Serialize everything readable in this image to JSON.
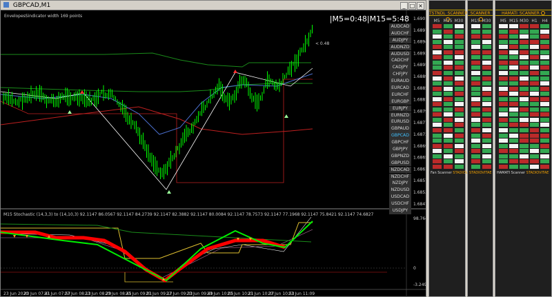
{
  "window": {
    "title": "GBPCAD,M1"
  },
  "chart": {
    "indicator_label": "EnvelopesSindicator width 169 points",
    "timer_text": "|M5=0:48|M15=5:48",
    "price_tag": "< 0.48",
    "price_labels": [
      "1.69015",
      "1.68975",
      "1.68945",
      "1.68935",
      "1.68955",
      "1.68895",
      "1.68855",
      "1.68815",
      "1.68795",
      "1.68775",
      "1.68735",
      "1.68695",
      "1.68655",
      "1.68615",
      "1.68575",
      "1.68535",
      "1.68475"
    ],
    "stoch_label": "M15 Stochastic (14,3,3) to (14,10,3) 92.1147 86.0567 92.1147 84.2739 92.1147 82.3882 92.1147 80.0084 92.1147 78.7573 92.1147 77.1968 92.1147 75.8421 92.1147 74.6827",
    "stoch_levels": [
      "98.7649",
      "0",
      "-3.2491"
    ],
    "time_labels": [
      "23 Jun 2020",
      "23 Jun 07:41",
      "23 Jun 07:57",
      "23 Jun 08:13",
      "23 Jun 08:29",
      "23 Jun 08:45",
      "23 Jun 09:01",
      "23 Jun 09:17",
      "23 Jun 09:33",
      "23 Jun 09:49",
      "23 Jun 10:05",
      "23 Jun 10:21",
      "23 Jun 10:37",
      "23 Jun 10:53",
      "23 Jun 11:09"
    ],
    "pairs": [
      "AUDCAD",
      "AUDCHF",
      "AUDJPY",
      "AUDNZD",
      "AUDUSD",
      "CADCHF",
      "CADJPY",
      "CHFJPY",
      "EURAUD",
      "EURCAD",
      "EURCHF",
      "EURGBP",
      "EURJPY",
      "EURNZD",
      "EURUSD",
      "GBPAUD",
      "GBPCAD",
      "GBPCHF",
      "GBPJPY",
      "GBPNZD",
      "GBPUSD",
      "NZDCAD",
      "NZDCHF",
      "NZDJPY",
      "NZDUSD",
      "USDCAD",
      "USDCHF",
      "USDJPY"
    ],
    "active_pair": "GBPCAD",
    "colors": {
      "candle": "#00ff00",
      "envelope_green": "#1a8c1a",
      "envelope_red": "#c02020",
      "ma_white": "#ffffff",
      "blue_line": "#4a6ecc",
      "signal": "#ff3030"
    }
  },
  "panels": [
    {
      "title": "TSTNDL_SCANNER",
      "headers": [
        "M5",
        "M15",
        "M30"
      ],
      "footer_a": "Fan Scanner",
      "footer_b": "STADIOVITAE"
    },
    {
      "title": "SCANNER",
      "headers": [
        "M15",
        "M30"
      ],
      "footer_a": "",
      "footer_b": "STADIOVITAE"
    },
    {
      "title": "HAMATI_SCANNER",
      "headers": [
        "M5",
        "M15",
        "M30",
        "H1",
        "H4"
      ],
      "footer_a": "HAMATI Scanner",
      "footer_b": "STADIOVITAE"
    }
  ]
}
